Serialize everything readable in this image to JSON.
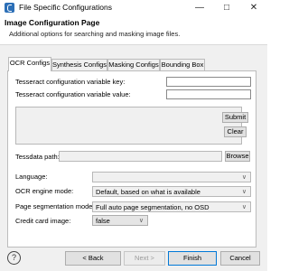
{
  "window": {
    "title": "File Specific Configurations",
    "minimize_icon": "minimize-icon",
    "maximize_icon": "maximize-icon",
    "close_icon": "close-icon"
  },
  "header": {
    "title": "Image Configuration Page",
    "subtitle": "Additional options for searching and masking image files."
  },
  "tabs": [
    {
      "label": "OCR Configs",
      "active": true
    },
    {
      "label": "Synthesis Configs",
      "active": false
    },
    {
      "label": "Masking Configs",
      "active": false
    },
    {
      "label": "Bounding Box",
      "active": false
    }
  ],
  "form": {
    "key_label": "Tesseract configuration variable key:",
    "key_value": "",
    "value_label": "Tesseract configuration variable value:",
    "value_value": "",
    "submit_label": "Submit",
    "clear_label": "Clear",
    "tessdata_label": "Tessdata path:",
    "tessdata_value": "",
    "browse_label": "Browse",
    "language_label": "Language:",
    "language_value": "",
    "ocr_mode_label": "OCR engine mode:",
    "ocr_mode_value": "Default, based on what is available",
    "segmentation_label": "Page segmentation mode:",
    "segmentation_value": "Full auto page segmentation, no OSD",
    "credit_card_label": "Credit card image:",
    "credit_card_value": "false"
  },
  "footer": {
    "help_glyph": "?",
    "back_label": "< Back",
    "next_label": "Next >",
    "finish_label": "Finish",
    "cancel_label": "Cancel"
  },
  "colors": {
    "window_bg": "#f0f0f0",
    "panel_bg": "#ffffff",
    "primary_border": "#0078d7",
    "app_icon": "#2c6fb7"
  }
}
